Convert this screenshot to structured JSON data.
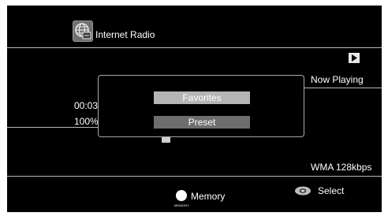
{
  "header": {
    "source_name": "Internet Radio",
    "source_icon": "globe-radio-icon"
  },
  "player": {
    "status": "Now Playing",
    "status_icon": "play-icon",
    "elapsed_time": "00:03",
    "buffer": "100%",
    "bitrate": "WMA 128kbps"
  },
  "popup_menu": {
    "items": [
      {
        "label": "Favorites",
        "selected": true
      },
      {
        "label": "Preset",
        "selected": false
      }
    ]
  },
  "footer": {
    "memory_label": "Memory",
    "memory_key_caption": "MEMORY",
    "memory_icon": "circle-button-icon",
    "select_label": "Select",
    "select_icon": "dpad-select-icon"
  },
  "colors": {
    "background": "#000000",
    "text": "#ffffff",
    "divider": "#b9b9b9",
    "menu_selected": "#b5b5b5",
    "menu_unselected": "#6e6e6e"
  }
}
